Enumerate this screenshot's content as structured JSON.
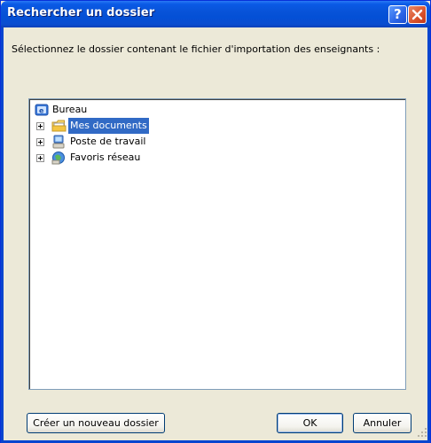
{
  "dialog": {
    "title": "Rechercher un dossier",
    "instruction": "Sélectionnez le dossier contenant le fichier d'importation des enseignants :",
    "tree": {
      "root": {
        "label": "Bureau",
        "icon": "desktop-icon"
      },
      "items": [
        {
          "label": "Mes documents",
          "icon": "folder-icon",
          "selected": true
        },
        {
          "label": "Poste de travail",
          "icon": "computer-icon",
          "selected": false
        },
        {
          "label": "Favoris réseau",
          "icon": "network-icon",
          "selected": false
        }
      ]
    },
    "buttons": {
      "new_folder": "Créer un nouveau dossier",
      "ok": "OK",
      "cancel": "Annuler"
    },
    "colors": {
      "titlebar": "#0a5ae6",
      "selection": "#316ac5",
      "face": "#ece9d8"
    }
  }
}
